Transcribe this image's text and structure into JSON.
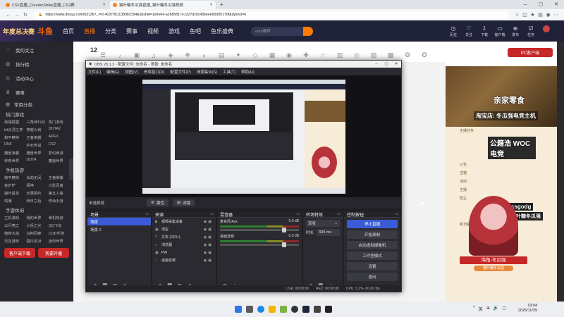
{
  "browser": {
    "tabs": [
      {
        "label": "CS2直播_CounterStrike直播_CS2赛",
        "active": false
      },
      {
        "label": "猫叶糖冬瓜强直播_猫叶糖冬瓜强视频",
        "active": true
      }
    ],
    "url": "https://www.douyu.com/631367_r=0.4037051138083154&dyshid=1e9e04-a2685817e1227dc0c43beee50005170f&dyshci=6"
  },
  "douyu": {
    "year_badge": "年度总决赛",
    "logo": "斗鱼",
    "nav": [
      "首页",
      "直播",
      "分类",
      "赛事",
      "视频",
      "游戏",
      "鱼吧",
      "鱼乐盛典"
    ],
    "nav_active": 1,
    "search_placeholder": "eom推荐",
    "header_icons": [
      "历史",
      "关注",
      "下载",
      "客户端",
      "发布",
      "任务"
    ],
    "pc_button": "PC客户端",
    "view_count": "12"
  },
  "sidebar": {
    "top_items": [
      "我的关注",
      "排行榜",
      "活动中心",
      "赛事"
    ],
    "common_header": "常用分类",
    "hot_header": "热门游戏",
    "hot_games": [
      "英雄联盟",
      "三角洲行动",
      "热门游戏",
      "lol云顶之弈",
      "穿越火线",
      "DOTA2",
      "和平精英",
      "王者荣耀",
      "APEX",
      "DNF",
      "炉石传说",
      "CS2",
      "魔兽争霸",
      "魔兽世界",
      "梦幻西游",
      "传奇世界",
      "DOTA",
      "魔兽世界"
    ],
    "mobile_header": "手机热游",
    "mobile_games": [
      "和平精英",
      "永劫无间",
      "王者荣耀",
      "金铲铲",
      "原神",
      "火影忍者",
      "崩坏星穹",
      "无畏契约",
      "第五人格",
      "鸣潮",
      "明日之后",
      "修仙手游"
    ],
    "life_header": "手游休闲",
    "life_games": [
      "主机游戏",
      "我的世界",
      "单机热游",
      "以闪亮之",
      "火炬之光",
      "QQ飞车",
      "植物大战",
      "白荆回廊",
      "COD手游",
      "交互游戏",
      "蛋仔派对",
      "迷你世界"
    ],
    "btn_left": "客户端下载",
    "btn_right": "我要开播"
  },
  "obs": {
    "title": "OBS 29.1.3 - 配置文件: 未命名 - 场景: 未命名",
    "menu": [
      "文件(F)",
      "编辑(E)",
      "视图(V)",
      "停靠窗口(D)",
      "配置文件(P)",
      "场景集合(S)",
      "工具(T)",
      "帮助(H)"
    ],
    "source_label": "未选择源",
    "props_btn": "属性",
    "filter_btn": "滤镜",
    "docks": {
      "scenes": {
        "title": "场景",
        "items": [
          "场景",
          "场景 2"
        ],
        "selected": 0
      },
      "sources": {
        "title": "来源",
        "items": [
          "视频采集设备",
          "淘宝",
          "文本 (GDI+)",
          "浏览器",
          "PW",
          "桌面音频"
        ]
      },
      "mixer": {
        "title": "混音器",
        "channels": [
          {
            "name": "麦克风/Aux",
            "db": "0.0 dB"
          },
          {
            "name": "桌面音频",
            "db": "0.0 dB"
          }
        ]
      },
      "transitions": {
        "title": "转场特效",
        "type": "渐变",
        "duration_label": "时长",
        "duration": "300 ms"
      },
      "controls": {
        "title": "控制按钮",
        "buttons": [
          "停止直播",
          "开始录制",
          "启动虚拟摄像机",
          "工作室模式",
          "设置",
          "退出"
        ]
      }
    },
    "status": {
      "live": "LIVE: 00:00:00",
      "rec": "REC: 00:00:00",
      "cpu": "CPU: 1.2%, 60.00 fps"
    }
  },
  "right": {
    "tiktok1": "亲家零食",
    "tiktok2": "淘宝店: 冬瓜强电竞主机",
    "woc": "公籍浩 WOC电竞",
    "csgo": "csgodg",
    "tiktok3": "猫叶糖冬瓜强",
    "chat": [
      "主播任务",
      "公告",
      "宝箱",
      "活动",
      "主播",
      "帮主",
      "新功能"
    ],
    "anchor_name": "海角-冬瓜强",
    "anchor_sub": "猫叶糖冬瓜强"
  },
  "taskbar": {
    "time": "19:04",
    "date": "2025/11/29",
    "tray": [
      "^",
      "英",
      "⊕",
      "🔊",
      "▢"
    ]
  },
  "colors": {
    "douyu_header": "#1f2238",
    "accent": "#ff7a00",
    "obs_blue": "#3b5bd6",
    "red_btn": "#c62828"
  }
}
